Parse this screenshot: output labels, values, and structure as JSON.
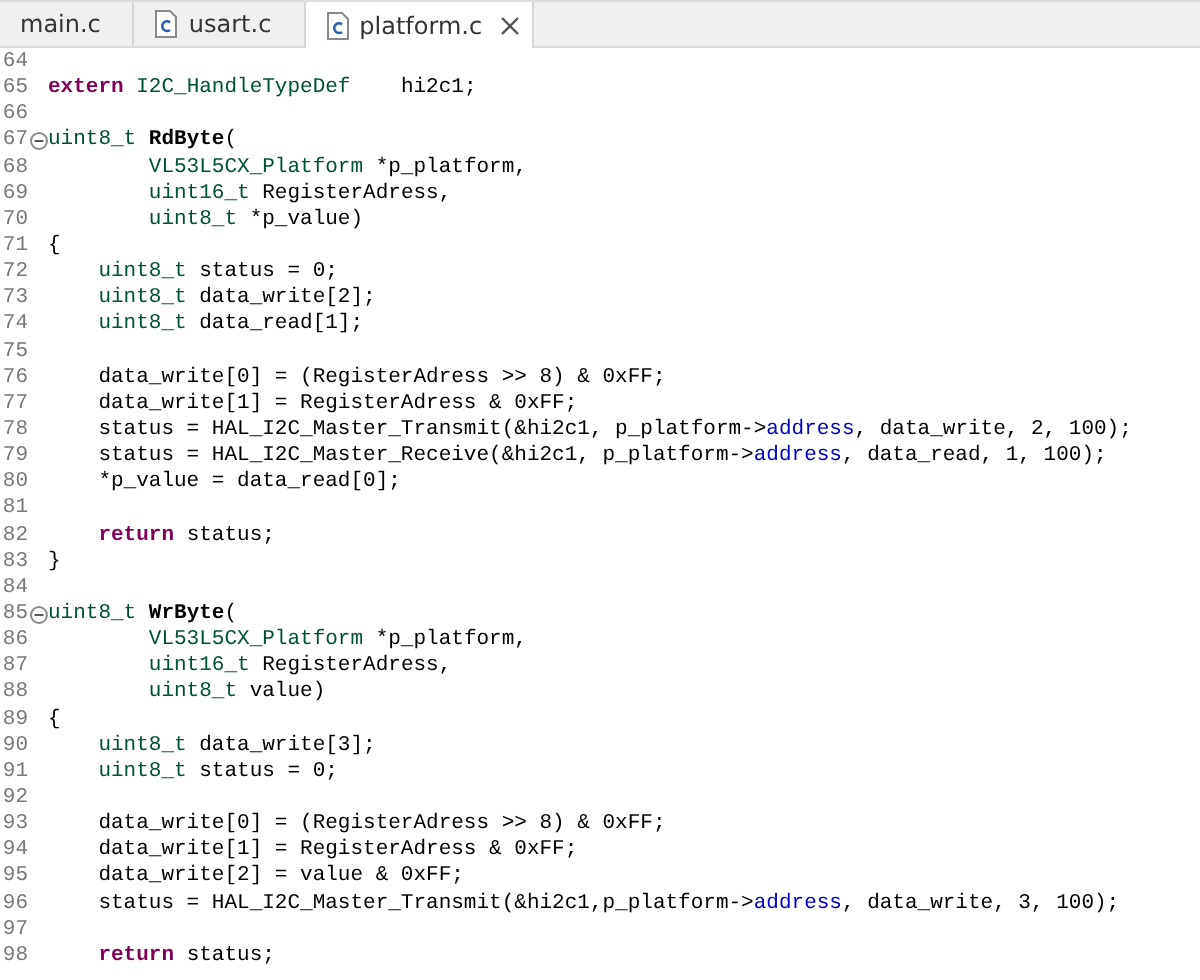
{
  "tabs": [
    {
      "label": "main.c",
      "icon": false,
      "selected": false,
      "closable": false
    },
    {
      "label": "usart.c",
      "icon": true,
      "selected": false,
      "closable": false
    },
    {
      "label": "platform.c",
      "icon": true,
      "selected": true,
      "closable": true
    }
  ],
  "editor": {
    "lines": [
      {
        "num": "64",
        "fold": false
      },
      {
        "num": "65",
        "fold": false,
        "tokens": [
          {
            "kind": "kw",
            "t": "extern"
          },
          {
            "kind": "ty",
            "t": " I2C_HandleTypeDef"
          },
          {
            "kind": "p",
            "t": "    hi2c1;"
          }
        ]
      },
      {
        "num": "66",
        "fold": false
      },
      {
        "num": "67",
        "fold": true,
        "tokens": [
          {
            "kind": "ty",
            "t": "uint8_t "
          },
          {
            "kind": "fn",
            "t": "RdByte"
          },
          {
            "kind": "p",
            "t": "("
          }
        ]
      },
      {
        "num": "68",
        "fold": false,
        "tokens": [
          {
            "kind": "ty",
            "t": "        VL53L5CX_Platform"
          },
          {
            "kind": "p",
            "t": " *p_platform,"
          }
        ]
      },
      {
        "num": "69",
        "fold": false,
        "tokens": [
          {
            "kind": "ty",
            "t": "        uint16_t"
          },
          {
            "kind": "p",
            "t": " RegisterAdress,"
          }
        ]
      },
      {
        "num": "70",
        "fold": false,
        "tokens": [
          {
            "kind": "ty",
            "t": "        uint8_t"
          },
          {
            "kind": "p",
            "t": " *p_value)"
          }
        ]
      },
      {
        "num": "71",
        "fold": false,
        "tokens": [
          {
            "kind": "p",
            "t": "{"
          }
        ]
      },
      {
        "num": "72",
        "fold": false,
        "tokens": [
          {
            "kind": "ty",
            "t": "    uint8_t"
          },
          {
            "kind": "p",
            "t": " status = 0;"
          }
        ]
      },
      {
        "num": "73",
        "fold": false,
        "tokens": [
          {
            "kind": "ty",
            "t": "    uint8_t"
          },
          {
            "kind": "p",
            "t": " data_write[2];"
          }
        ]
      },
      {
        "num": "74",
        "fold": false,
        "tokens": [
          {
            "kind": "ty",
            "t": "    uint8_t"
          },
          {
            "kind": "p",
            "t": " data_read[1];"
          }
        ]
      },
      {
        "num": "75",
        "fold": false
      },
      {
        "num": "76",
        "fold": false,
        "tokens": [
          {
            "kind": "p",
            "t": "    data_write[0] = (RegisterAdress >> 8) & 0xFF;"
          }
        ]
      },
      {
        "num": "77",
        "fold": false,
        "tokens": [
          {
            "kind": "p",
            "t": "    data_write[1] = RegisterAdress & 0xFF;"
          }
        ]
      },
      {
        "num": "78",
        "fold": false,
        "tokens": [
          {
            "kind": "p",
            "t": "    status = HAL_I2C_Master_Transmit(&hi2c1, p_platform->"
          },
          {
            "kind": "fld",
            "t": "address"
          },
          {
            "kind": "p",
            "t": ", data_write, 2, 100);"
          }
        ]
      },
      {
        "num": "79",
        "fold": false,
        "tokens": [
          {
            "kind": "p",
            "t": "    status = HAL_I2C_Master_Receive(&hi2c1, p_platform->"
          },
          {
            "kind": "fld",
            "t": "address"
          },
          {
            "kind": "p",
            "t": ", data_read, 1, 100);"
          }
        ]
      },
      {
        "num": "80",
        "fold": false,
        "tokens": [
          {
            "kind": "p",
            "t": "    *p_value = data_read[0];"
          }
        ]
      },
      {
        "num": "81",
        "fold": false
      },
      {
        "num": "82",
        "fold": false,
        "tokens": [
          {
            "kind": "kw",
            "t": "    return"
          },
          {
            "kind": "p",
            "t": " status;"
          }
        ]
      },
      {
        "num": "83",
        "fold": false,
        "tokens": [
          {
            "kind": "p",
            "t": "}"
          }
        ]
      },
      {
        "num": "84",
        "fold": false
      },
      {
        "num": "85",
        "fold": true,
        "tokens": [
          {
            "kind": "ty",
            "t": "uint8_t "
          },
          {
            "kind": "fn",
            "t": "WrByte"
          },
          {
            "kind": "p",
            "t": "("
          }
        ]
      },
      {
        "num": "86",
        "fold": false,
        "tokens": [
          {
            "kind": "ty",
            "t": "        VL53L5CX_Platform"
          },
          {
            "kind": "p",
            "t": " *p_platform,"
          }
        ]
      },
      {
        "num": "87",
        "fold": false,
        "tokens": [
          {
            "kind": "ty",
            "t": "        uint16_t"
          },
          {
            "kind": "p",
            "t": " RegisterAdress,"
          }
        ]
      },
      {
        "num": "88",
        "fold": false,
        "tokens": [
          {
            "kind": "ty",
            "t": "        uint8_t"
          },
          {
            "kind": "p",
            "t": " value)"
          }
        ]
      },
      {
        "num": "89",
        "fold": false,
        "tokens": [
          {
            "kind": "p",
            "t": "{"
          }
        ]
      },
      {
        "num": "90",
        "fold": false,
        "tokens": [
          {
            "kind": "ty",
            "t": "    uint8_t"
          },
          {
            "kind": "p",
            "t": " data_write[3];"
          }
        ]
      },
      {
        "num": "91",
        "fold": false,
        "tokens": [
          {
            "kind": "ty",
            "t": "    uint8_t"
          },
          {
            "kind": "p",
            "t": " status = 0;"
          }
        ]
      },
      {
        "num": "92",
        "fold": false
      },
      {
        "num": "93",
        "fold": false,
        "tokens": [
          {
            "kind": "p",
            "t": "    data_write[0] = (RegisterAdress >> 8) & 0xFF;"
          }
        ]
      },
      {
        "num": "94",
        "fold": false,
        "tokens": [
          {
            "kind": "p",
            "t": "    data_write[1] = RegisterAdress & 0xFF;"
          }
        ]
      },
      {
        "num": "95",
        "fold": false,
        "tokens": [
          {
            "kind": "p",
            "t": "    data_write[2] = value & 0xFF;"
          }
        ]
      },
      {
        "num": "96",
        "fold": false,
        "tokens": [
          {
            "kind": "p",
            "t": "    status = HAL_I2C_Master_Transmit(&hi2c1,p_platform->"
          },
          {
            "kind": "fld",
            "t": "address"
          },
          {
            "kind": "p",
            "t": ", data_write, 3, 100);"
          }
        ]
      },
      {
        "num": "97",
        "fold": false
      },
      {
        "num": "98",
        "fold": false,
        "tokens": [
          {
            "kind": "kw",
            "t": "    return"
          },
          {
            "kind": "p",
            "t": " status;"
          }
        ]
      }
    ]
  }
}
